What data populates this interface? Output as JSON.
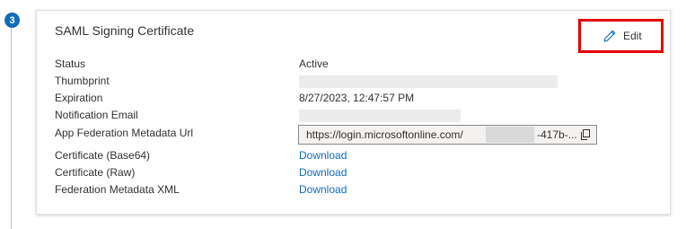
{
  "step": {
    "number": "3"
  },
  "card": {
    "title": "SAML Signing Certificate",
    "edit_label": "Edit",
    "fields": {
      "status_label": "Status",
      "status_value": "Active",
      "thumbprint_label": "Thumbprint",
      "expiration_label": "Expiration",
      "expiration_value": "8/27/2023, 12:47:57 PM",
      "notification_email_label": "Notification Email",
      "metadata_url_label": "App Federation Metadata Url",
      "metadata_url_prefix": "https://login.microsoftonline.com/",
      "metadata_url_suffix": "-417b-...",
      "cert_base64_label": "Certificate (Base64)",
      "cert_raw_label": "Certificate (Raw)",
      "federation_xml_label": "Federation Metadata XML"
    },
    "links": {
      "cert_base64": "Download",
      "cert_raw": "Download",
      "federation_xml": "Download"
    }
  },
  "colors": {
    "accent": "#0f6cbd",
    "highlight": "#e30000"
  },
  "icons": {
    "edit": "pencil-icon",
    "copy": "copy-icon"
  }
}
